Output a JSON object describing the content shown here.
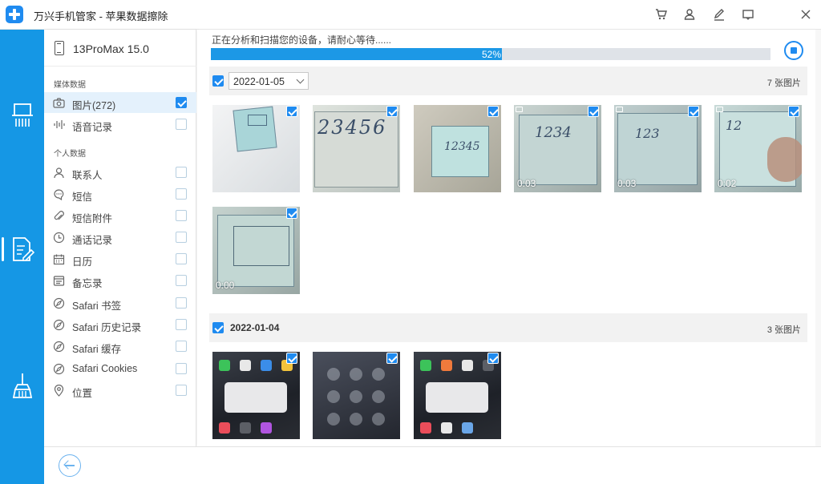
{
  "titlebar": {
    "title": "万兴手机管家 - 苹果数据擦除",
    "buttons": [
      "cart-icon",
      "user-icon",
      "feedback-icon",
      "minimize-icon",
      "close-icon"
    ]
  },
  "rail": {
    "items": [
      {
        "icon": "erase-machine-icon",
        "active": false
      },
      {
        "icon": "document-erase-icon",
        "active": true
      },
      {
        "icon": "broom-icon",
        "active": false
      }
    ]
  },
  "sidebar": {
    "device_name": "13ProMax 15.0",
    "section_media": "媒体数据",
    "section_personal": "个人数据",
    "media_items": [
      {
        "label": "图片(272)",
        "icon": "camera-icon",
        "checked": true,
        "selected": true
      },
      {
        "label": "语音记录",
        "icon": "waveform-icon",
        "checked": false,
        "selected": false
      }
    ],
    "personal_items": [
      {
        "label": "联系人",
        "icon": "contact-icon",
        "checked": false
      },
      {
        "label": "短信",
        "icon": "message-icon",
        "checked": false
      },
      {
        "label": "短信附件",
        "icon": "attachment-icon",
        "checked": false
      },
      {
        "label": "通话记录",
        "icon": "clock-icon",
        "checked": false
      },
      {
        "label": "日历",
        "icon": "calendar-icon",
        "checked": false
      },
      {
        "label": "备忘录",
        "icon": "notes-icon",
        "checked": false
      },
      {
        "label": "Safari 书签",
        "icon": "safari-icon",
        "checked": false
      },
      {
        "label": "Safari 历史记录",
        "icon": "safari-icon",
        "checked": false
      },
      {
        "label": "Safari 缓存",
        "icon": "safari-icon",
        "checked": false
      },
      {
        "label": "Safari Cookies",
        "icon": "safari-icon",
        "checked": false
      },
      {
        "label": "位置",
        "icon": "location-icon",
        "checked": false
      }
    ]
  },
  "main": {
    "scan_text": "正在分析和扫描您的设备，请耐心等待......",
    "progress": 0.52,
    "progress_text": "52%",
    "groups": [
      {
        "date": "2022-01-05",
        "count": "7 张图片",
        "checked": true,
        "thumbs": [
          {
            "kind": "note",
            "text": "",
            "duration": "",
            "video": false
          },
          {
            "kind": "note",
            "text": "23456",
            "duration": "",
            "video": false
          },
          {
            "kind": "note",
            "text": "12345",
            "duration": "",
            "video": false
          },
          {
            "kind": "note",
            "text": "1234",
            "duration": "0:03",
            "video": true
          },
          {
            "kind": "note",
            "text": "123",
            "duration": "0:03",
            "video": true
          },
          {
            "kind": "note",
            "text": "12",
            "duration": "0:02",
            "video": true
          },
          {
            "kind": "note",
            "text": "",
            "duration": "0:00",
            "video": false
          }
        ]
      },
      {
        "date": "2022-01-04",
        "count": "3 张图片",
        "checked": true,
        "thumbs": [
          {
            "kind": "home",
            "duration": ""
          },
          {
            "kind": "keypad",
            "duration": ""
          },
          {
            "kind": "home",
            "duration": ""
          }
        ]
      }
    ]
  },
  "colors": {
    "accent": "#1f8bf0",
    "rail": "#1597e5",
    "progress": "#1c98e6"
  }
}
